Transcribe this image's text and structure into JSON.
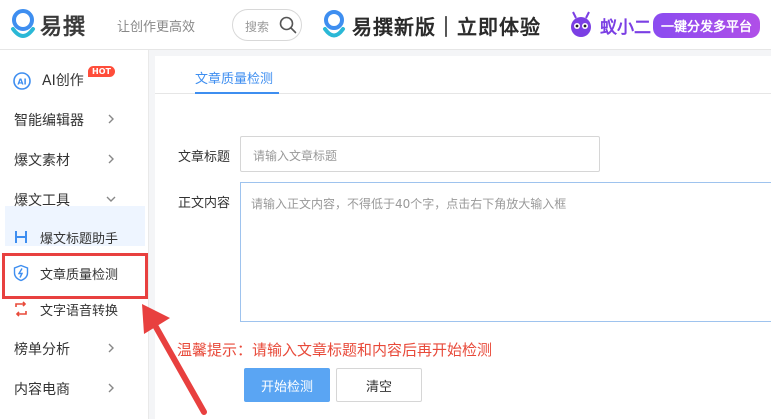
{
  "header": {
    "logo_text": "易撰",
    "slogan": "让创作更高效",
    "search_placeholder": "搜索",
    "promo_text": "易撰新版｜立即体验",
    "ant_brand": "蚁小二",
    "ant_pill": "一键分发多平台"
  },
  "sidebar": {
    "ai_label": "AI创作",
    "hot_badge": "HOT",
    "items": [
      {
        "label": "智能编辑器"
      },
      {
        "label": "爆文素材"
      },
      {
        "label": "爆文工具"
      },
      {
        "label": "榜单分析"
      },
      {
        "label": "内容电商"
      }
    ],
    "sub_items": [
      {
        "label": "爆文标题助手"
      },
      {
        "label": "文章质量检测"
      },
      {
        "label": "文字语音转换"
      }
    ]
  },
  "main": {
    "tab_label": "文章质量检测",
    "title_label": "文章标题",
    "title_placeholder": "请输入文章标题",
    "content_label": "正文内容",
    "content_placeholder": "请输入正文内容，不得低于40个字，点击右下角放大输入框",
    "warning": "温馨提示：请输入文章标题和内容后再开始检测",
    "start_button": "开始检测",
    "clear_button": "清空"
  },
  "colors": {
    "accent": "#3e8ef0",
    "warning": "#e84a3a",
    "highlight_box": "#e8403f",
    "primary_button": "#5aa5f3"
  }
}
